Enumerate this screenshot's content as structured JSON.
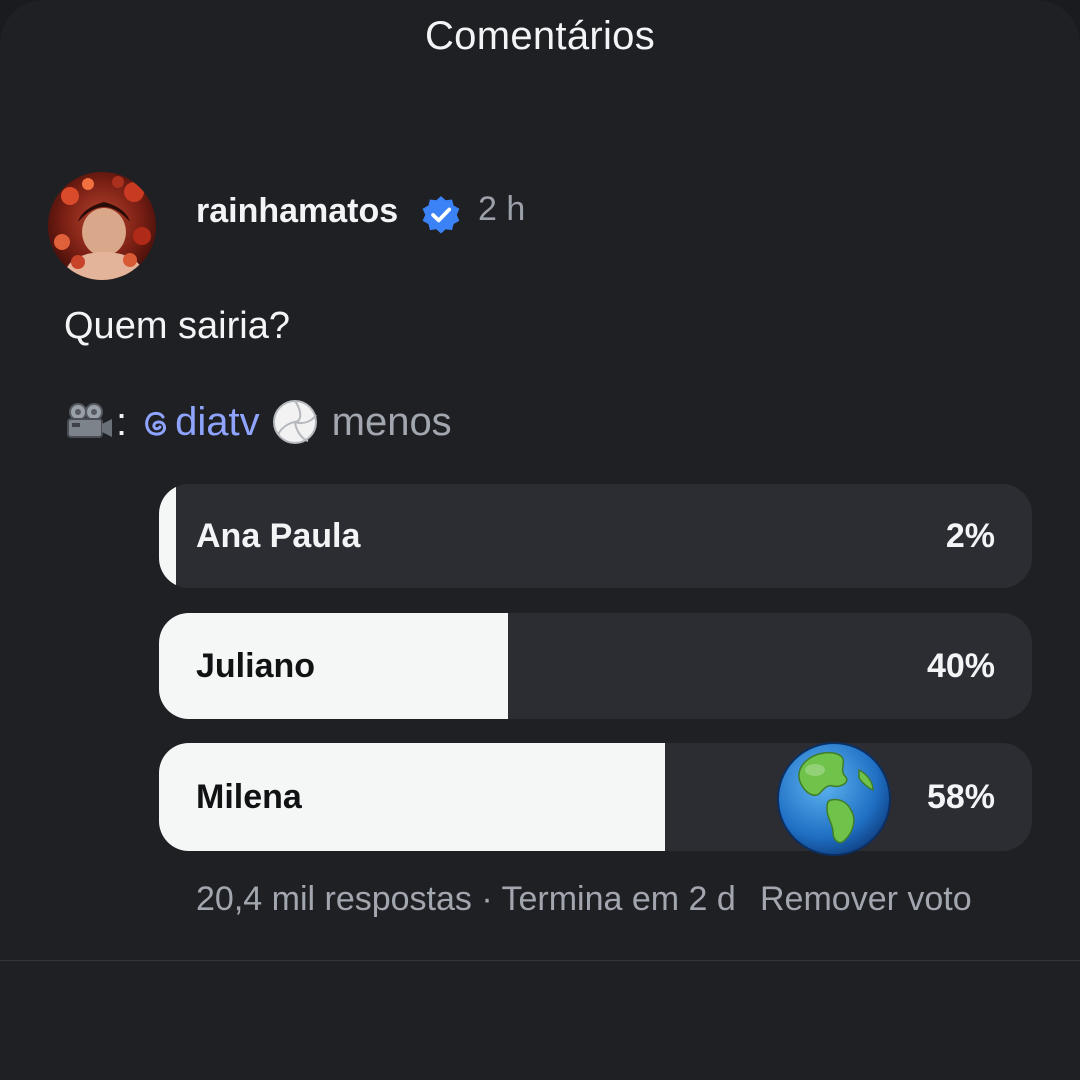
{
  "header": {
    "title": "Comentários"
  },
  "post": {
    "username": "rainhamatos",
    "verified": true,
    "time": "2 h",
    "text": "Quem sairia?",
    "credit": {
      "camera_icon": "movie-camera-icon",
      "colon": ":",
      "mention": "diatv",
      "mention_icon": "threads-icon",
      "emoji_icon": "volleyball-icon",
      "less_label": "menos"
    }
  },
  "poll": {
    "options": [
      {
        "label": "Ana Paula",
        "percent_text": "2%",
        "percent": 2
      },
      {
        "label": "Juliano",
        "percent_text": "40%",
        "percent": 40
      },
      {
        "label": "Milena",
        "percent_text": "58%",
        "percent": 58,
        "selected_icon": "globe-americas-icon"
      }
    ],
    "meta": "20,4 mil respostas · Termina em 2 d",
    "remove_vote": "Remover voto"
  },
  "colors": {
    "background": "#1f2024",
    "option_track": "#2c2d33",
    "option_fill": "#f5f7f6",
    "mention": "#8ea4ff",
    "verified": "#3b82f6",
    "muted_text": "#a2a6ae"
  }
}
